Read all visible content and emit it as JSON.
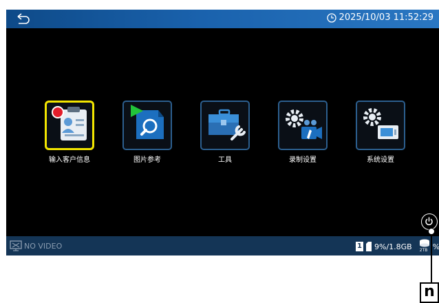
{
  "header": {
    "datetime": "2025/10/03 11:52:29",
    "back_icon": "back-arrow-icon",
    "clock_icon": "clock-icon"
  },
  "menu": {
    "items": [
      {
        "label": "输入客户信息",
        "icon": "customer-info-icon",
        "selected": true
      },
      {
        "label": "图片参考",
        "icon": "image-reference-icon",
        "selected": false
      },
      {
        "label": "工具",
        "icon": "toolbox-icon",
        "selected": false
      },
      {
        "label": "录制设置",
        "icon": "recording-settings-icon",
        "selected": false
      },
      {
        "label": "系统设置",
        "icon": "system-settings-icon",
        "selected": false
      }
    ]
  },
  "status": {
    "video_status": "NO VIDEO",
    "storage_badge": "1",
    "storage_usage": "9%/1.8GB",
    "storage_capacity": "2TB",
    "storage_usage_2_fragment": "%"
  },
  "power_icon": "power-icon",
  "callout": {
    "letter": "n"
  },
  "colors": {
    "topbar": "#1a62ad",
    "statusbar": "#143556",
    "selected_border": "#f3e600",
    "tile_border": "#2c5f8f",
    "icon_blue": "#3a8fd8"
  }
}
